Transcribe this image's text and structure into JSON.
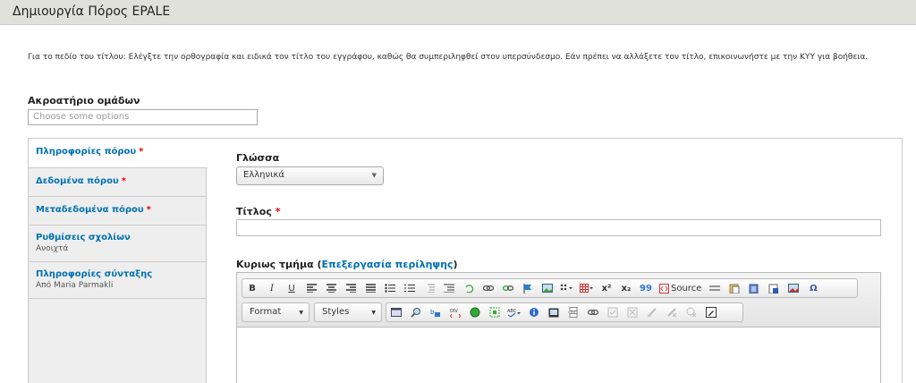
{
  "page": {
    "title": "Δημιουργία Πόρος EPALE",
    "help_text": "Για το πεδίο του τίτλου: Ελέγξτε την ορθογραφία και ειδικά τον τίτλο του εγγράφου, καθώς θα συμπεριληφθεί στον υπερσύνδεσμο. Εάν πρέπει να αλλάξετε τον τίτλο, επικοινωνήστε με την ΚΥΥ για βοήθεια."
  },
  "group_field": {
    "label": "Ακροατήριο ομάδων",
    "placeholder": "Choose some options"
  },
  "vertical_tabs": [
    {
      "label": "Πληροφορίες πόρου",
      "required": "*",
      "summary": ""
    },
    {
      "label": "Δεδομένα πόρου",
      "required": "*",
      "summary": ""
    },
    {
      "label": "Μεταδεδομένα πόρου",
      "required": "*",
      "summary": ""
    },
    {
      "label": "Ρυθμίσεις σχολίων",
      "required": "",
      "summary": "Ανοιχτά"
    },
    {
      "label": "Πληροφορίες σύνταξης",
      "required": "",
      "summary": "Από Maria Parmakli"
    }
  ],
  "form": {
    "language_label": "Γλώσσα",
    "language_value": "Ελληνικά",
    "title_label": "Τίτλος",
    "title_required": "*",
    "title_value": "",
    "body_label": "Κυριως τμήμα",
    "body_link": "Επεξεργασία περίληψης",
    "body_paren_open": "(",
    "body_paren_close": ")"
  },
  "editor": {
    "bold": "B",
    "italic": "I",
    "underline": "U",
    "superscript": "x²",
    "subscript": "x₂",
    "quote": "99",
    "source_label": "Source",
    "omega": "Ω",
    "format_label": "Format",
    "styles_label": "Styles"
  },
  "colors": {
    "link": "#0071b3",
    "required": "#ee0000",
    "titlebar": "#e1e1dc"
  }
}
